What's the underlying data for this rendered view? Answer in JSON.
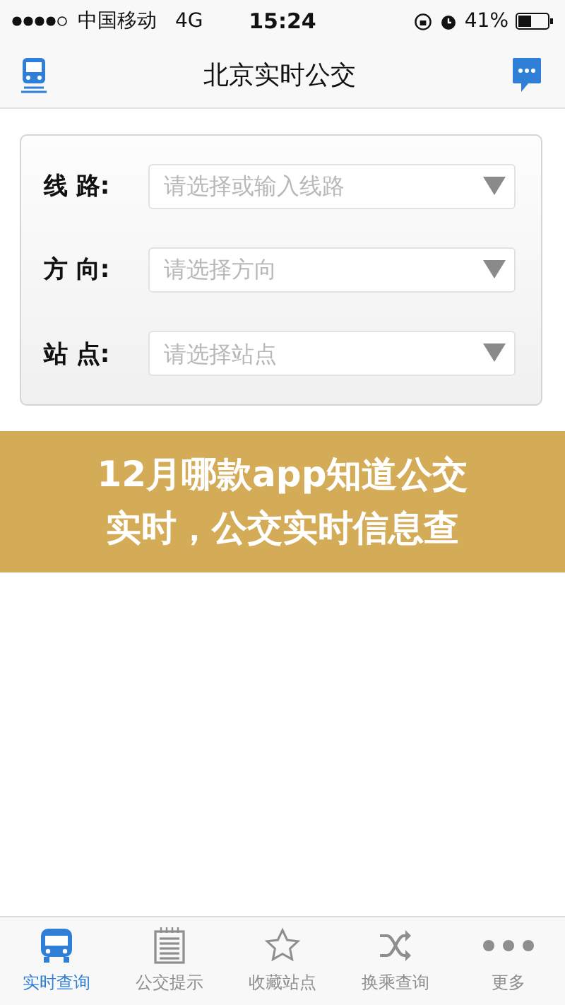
{
  "status_bar": {
    "carrier": "中国移动",
    "network": "4G",
    "time": "15:24",
    "battery": "41%"
  },
  "nav_bar": {
    "title": "北京实时公交"
  },
  "form": {
    "fields": [
      {
        "label": "线 路:",
        "placeholder": "请选择或输入线路"
      },
      {
        "label": "方 向:",
        "placeholder": "请选择方向"
      },
      {
        "label": "站 点:",
        "placeholder": "请选择站点"
      }
    ]
  },
  "banner": {
    "lines": [
      "12月哪款app知道公交",
      "实时，公交实时信息查"
    ]
  },
  "tab_bar": {
    "tabs": [
      {
        "label": "实时查询",
        "selected": true,
        "kind": "bus"
      },
      {
        "label": "公交提示",
        "selected": false,
        "kind": "notes"
      },
      {
        "label": "收藏站点",
        "selected": false,
        "kind": "star"
      },
      {
        "label": "换乘查询",
        "selected": false,
        "kind": "shuffle"
      },
      {
        "label": "更多",
        "selected": false,
        "kind": "more"
      }
    ]
  }
}
